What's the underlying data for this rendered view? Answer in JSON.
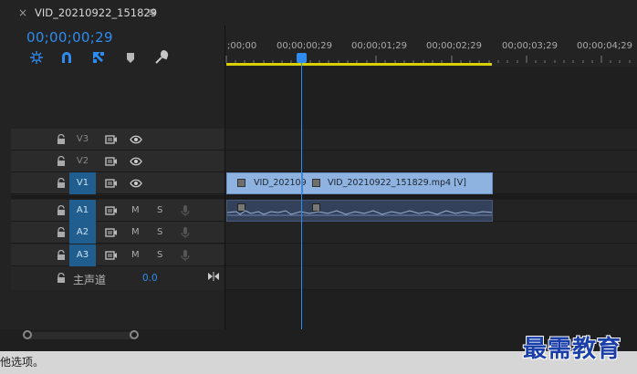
{
  "tab": {
    "close_glyph": "×",
    "title": "VID_20210922_151829",
    "menu_glyph": "≡"
  },
  "timecode": "00;00;00;29",
  "toolbar": [
    {
      "icon": "snap-to-sequence-icon"
    },
    {
      "icon": "magnet-snap-icon"
    },
    {
      "icon": "linked-selection-icon"
    },
    {
      "icon": "add-marker-icon"
    },
    {
      "icon": "wrench-settings-icon"
    }
  ],
  "ruler_labels": [
    ";00;00",
    "00;00;00;29",
    "00;00;01;29",
    "00;00;02;29",
    "00;00;03;29",
    "00;00;04;29"
  ],
  "tracks": {
    "video": [
      {
        "label": "V3",
        "targeted": false
      },
      {
        "label": "V2",
        "targeted": false
      },
      {
        "label": "V1",
        "targeted": true
      }
    ],
    "audio": [
      {
        "label": "A1",
        "targeted": true,
        "m": "M",
        "s": "S"
      },
      {
        "label": "A2",
        "targeted": true,
        "m": "M",
        "s": "S"
      },
      {
        "label": "A3",
        "targeted": true,
        "m": "M",
        "s": "S"
      }
    ],
    "master": {
      "label": "主声道",
      "value": "0.0"
    }
  },
  "clips": {
    "video_clip_1": "VID_202109",
    "video_clip_2": "VID_20210922_151829.mp4 [V]"
  },
  "status_text": "他选项。",
  "watermark_text": "最需教育",
  "colors": {
    "accent": "#2e8cf0",
    "work_area": "#d8d000",
    "video_clip": "#8fb3e0",
    "audio_clip": "#33425a"
  }
}
